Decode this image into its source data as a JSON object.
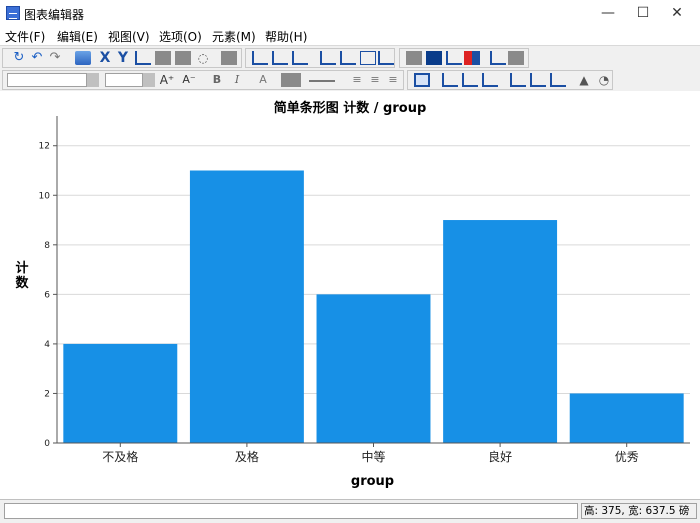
{
  "window": {
    "title": "图表编辑器",
    "controls": {
      "minimize": "—",
      "maximize": "☐",
      "close": "✕"
    }
  },
  "menu": [
    "文件(F)",
    "编辑(E)",
    "视图(V)",
    "选项(O)",
    "元素(M)",
    "帮助(H)"
  ],
  "toolbar": {
    "row1_icons": [
      "undo-icon",
      "rotate-left-icon",
      "rotate-right-icon",
      "properties-icon",
      "x-axis-icon",
      "y-axis-icon",
      "transpose-icon",
      "scale-icon",
      "fill-icon",
      "lasso-icon",
      "frame-icon",
      "bar-chart-icon",
      "line-chart-icon",
      "scatter-icon",
      "fit-line-icon",
      "interpolation-icon",
      "reference-line-icon",
      "annotation-icon",
      "textbox-icon",
      "footnote-icon",
      "data-labels-icon",
      "show-legend-icon"
    ],
    "row2_icons": [
      "font-size-up-icon",
      "font-size-down-icon",
      "bold-icon",
      "italic-icon",
      "text-color-icon",
      "fill-color-icon",
      "line-style-icon",
      "align-left-icon",
      "align-center-icon",
      "align-right-icon",
      "grid-icon",
      "bar-options-icon",
      "distribution-icon",
      "line-options-icon",
      "scatter-options-icon",
      "markers-icon",
      "3d-icon",
      "rotate-icon"
    ]
  },
  "chart_data": {
    "type": "bar",
    "title": "简单条形图 计数 / group",
    "xlabel": "group",
    "ylabel": "计数",
    "categories": [
      "不及格",
      "及格",
      "中等",
      "良好",
      "优秀"
    ],
    "values": [
      4,
      11,
      6,
      9,
      2
    ],
    "ylim": [
      0,
      13.2
    ],
    "yticks": [
      0,
      2,
      4,
      6,
      8,
      10,
      12
    ],
    "grid": true,
    "bar_color": "#1790e6"
  },
  "status": {
    "left": "",
    "right": "高: 375, 宽: 637.5 磅"
  }
}
